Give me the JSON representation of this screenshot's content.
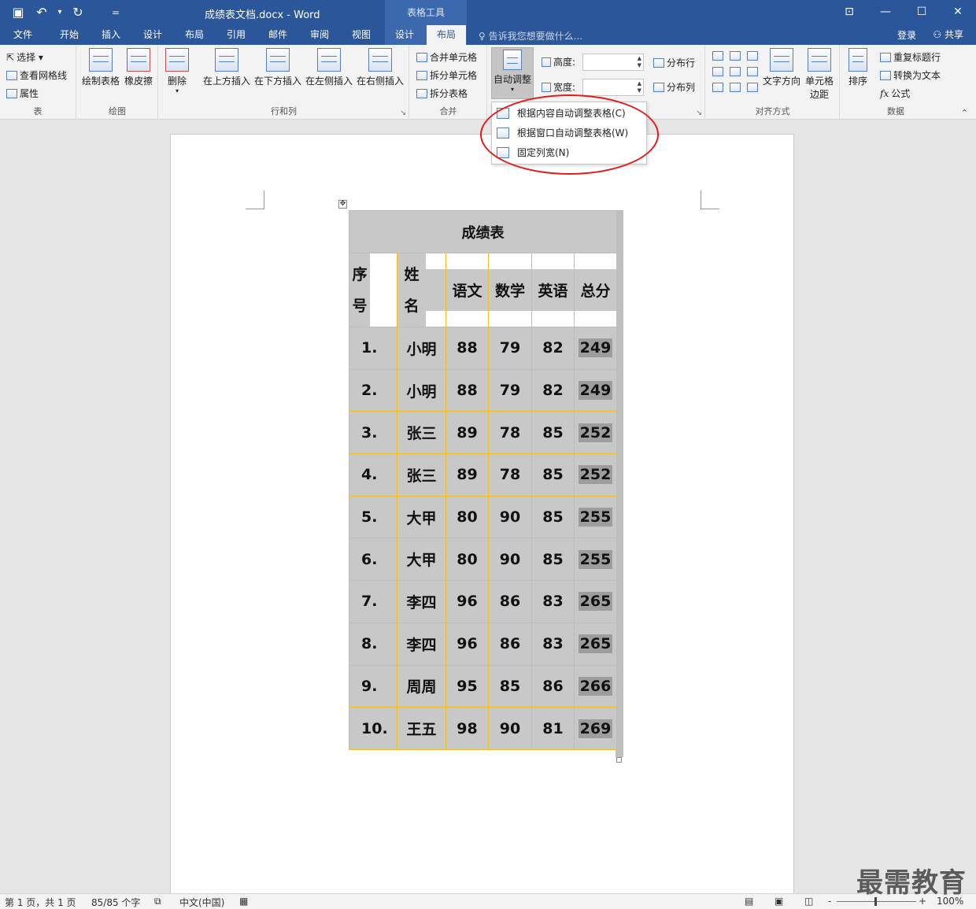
{
  "window": {
    "title": "成绩表文档.docx - Word",
    "context_title": "表格工具",
    "qat": {
      "save_icon": "▣",
      "undo_icon": "↶",
      "undo_dropdown": "▾",
      "redo_icon": "↻",
      "customize_icon": "="
    },
    "controls": {
      "ribbon_display": "⊡",
      "minimize": "—",
      "maximize": "☐",
      "close": "✕"
    }
  },
  "tabs": [
    {
      "label": "文件"
    },
    {
      "label": "开始"
    },
    {
      "label": "插入"
    },
    {
      "label": "设计"
    },
    {
      "label": "布局"
    },
    {
      "label": "引用"
    },
    {
      "label": "邮件"
    },
    {
      "label": "审阅"
    },
    {
      "label": "视图"
    },
    {
      "label": "设计"
    },
    {
      "label": "布局"
    }
  ],
  "tellme": "告诉我您想要做什么...",
  "account": {
    "login": "登录",
    "share": "共享"
  },
  "ribbon": {
    "table_group": {
      "select": "选择 ▾",
      "view_gridlines": "查看网格线",
      "properties": "属性",
      "label": "表"
    },
    "draw_group": {
      "draw_table": "绘制表格",
      "eraser": "橡皮擦",
      "label": "绘图"
    },
    "rows_cols_group": {
      "delete": "删除",
      "insert_above": "在上方插入",
      "insert_below": "在下方插入",
      "insert_left": "在左侧插入",
      "insert_right": "在右侧插入",
      "label": "行和列"
    },
    "merge_group": {
      "merge_cells": "合并单元格",
      "split_cells": "拆分单元格",
      "split_table": "拆分表格",
      "label": "合并"
    },
    "cell_size_group": {
      "autofit": "自动调整",
      "height_label": "高度:",
      "width_label": "宽度:",
      "height_value": "",
      "width_value": "",
      "distribute_rows": "分布行",
      "distribute_cols": "分布列"
    },
    "align_group": {
      "text_direction": "文字方向",
      "cell_margins_1": "单元格",
      "cell_margins_2": "边距",
      "label": "对齐方式"
    },
    "data_group": {
      "sort": "排序",
      "repeat_header": "重复标题行",
      "convert_text": "转换为文本",
      "formula": "公式",
      "label": "数据"
    }
  },
  "autofit_menu": [
    {
      "label": "根据内容自动调整表格(C)"
    },
    {
      "label": "根据窗口自动调整表格(W)"
    },
    {
      "label": "固定列宽(N)"
    }
  ],
  "table": {
    "title": "成绩表",
    "headers": {
      "index_1": "序",
      "index_2": "号",
      "name_1": "姓",
      "name_2": "名",
      "chinese": "语文",
      "math": "数学",
      "english": "英语",
      "total": "总分"
    },
    "rows": [
      {
        "no": "1.",
        "name": "小明",
        "chinese": "88",
        "math": "79",
        "english": "82",
        "total": "249"
      },
      {
        "no": "2.",
        "name": "小明",
        "chinese": "88",
        "math": "79",
        "english": "82",
        "total": "249"
      },
      {
        "no": "3.",
        "name": "张三",
        "chinese": "89",
        "math": "78",
        "english": "85",
        "total": "252"
      },
      {
        "no": "4.",
        "name": "张三",
        "chinese": "89",
        "math": "78",
        "english": "85",
        "total": "252"
      },
      {
        "no": "5.",
        "name": "大甲",
        "chinese": "80",
        "math": "90",
        "english": "85",
        "total": "255"
      },
      {
        "no": "6.",
        "name": "大甲",
        "chinese": "80",
        "math": "90",
        "english": "85",
        "total": "255"
      },
      {
        "no": "7.",
        "name": "李四",
        "chinese": "96",
        "math": "86",
        "english": "83",
        "total": "265"
      },
      {
        "no": "8.",
        "name": "李四",
        "chinese": "96",
        "math": "86",
        "english": "83",
        "total": "265"
      },
      {
        "no": "9.",
        "name": "周周",
        "chinese": "95",
        "math": "85",
        "english": "86",
        "total": "266"
      },
      {
        "no": "10.",
        "name": "王五",
        "chinese": "98",
        "math": "90",
        "english": "81",
        "total": "269"
      }
    ]
  },
  "status": {
    "page": "第 1 页，共 1 页",
    "words": "85/85 个字",
    "language": "中文(中国)",
    "zoom": "100%",
    "zoom_minus": "-",
    "zoom_plus": "+"
  },
  "watermark": "最需教育",
  "colors": {
    "accent": "#2b579a",
    "table_border": "#f0c02a",
    "cell_shade": "#c8c8c8",
    "annotation": "#e21b1b"
  }
}
